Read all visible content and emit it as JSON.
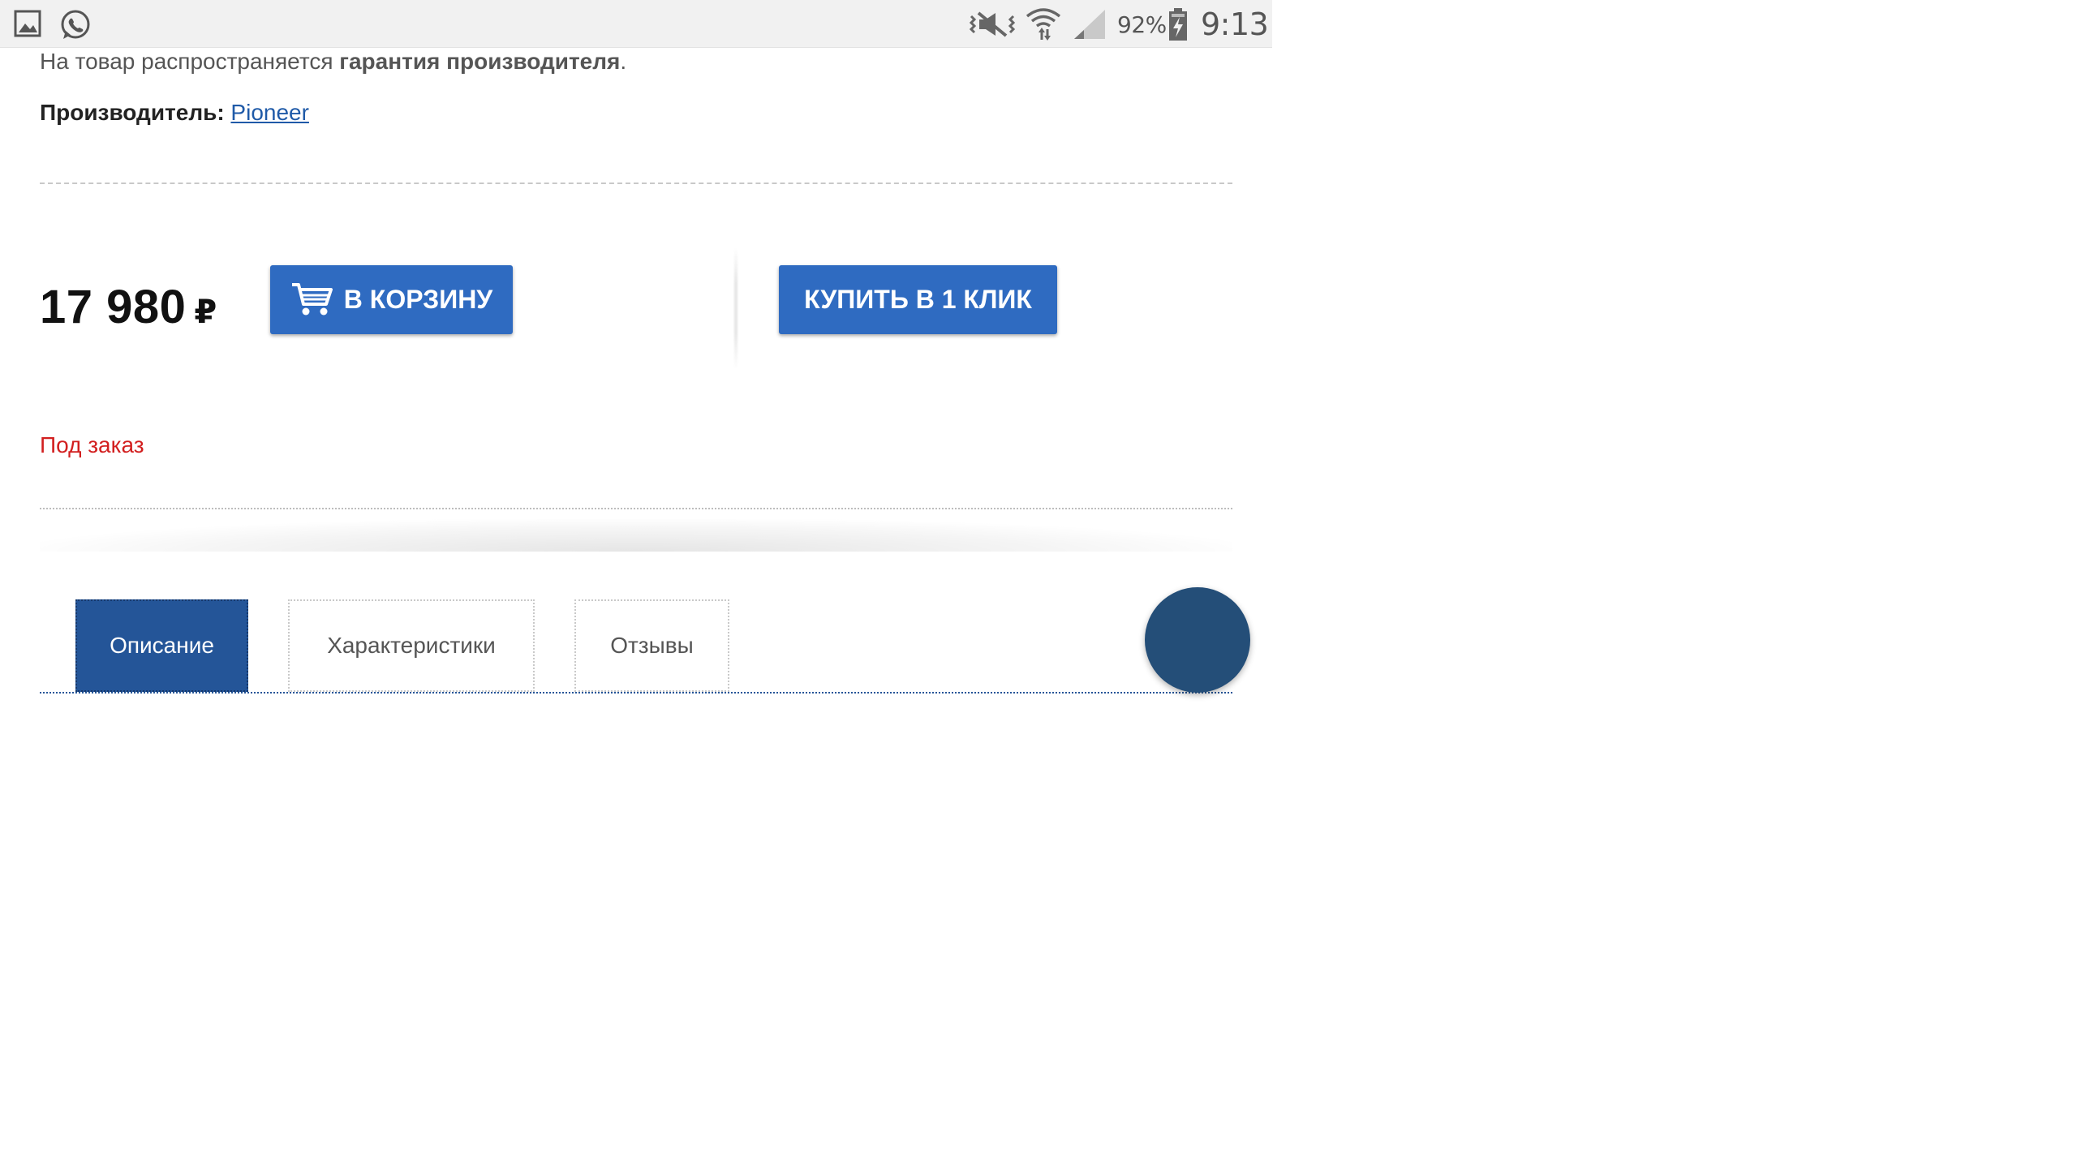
{
  "status_bar": {
    "left_icons": [
      "gallery-icon",
      "whatsapp-icon"
    ],
    "right_icons": [
      "mute-icon",
      "wifi-icon",
      "signal-icon",
      "battery-charging-icon"
    ],
    "battery": "92%",
    "time": "9:13"
  },
  "product": {
    "warranty_prefix": "На товар распространяется ",
    "warranty_bold": "гарантия производителя",
    "warranty_suffix": ".",
    "manufacturer_label": "Производитель:",
    "manufacturer_value": "Pioneer",
    "price": "17 980",
    "currency": "₽",
    "availability": "Под заказ"
  },
  "buttons": {
    "add_to_cart": "В КОРЗИНУ",
    "buy_one_click": "КУПИТЬ В 1 КЛИК"
  },
  "tabs": [
    {
      "label": "Описание",
      "active": true
    },
    {
      "label": "Характеристики",
      "active": false
    },
    {
      "label": "Отзывы",
      "active": false
    }
  ],
  "colors": {
    "accent_button": "#2f6bc1",
    "active_tab": "#245598",
    "link": "#1f5aa8",
    "availability": "#d21f1f",
    "fab": "#244e78"
  }
}
